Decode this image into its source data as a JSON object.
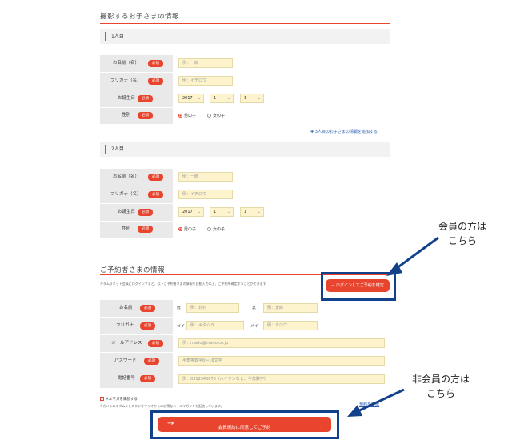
{
  "section1": {
    "title": "撮影するお子さまの情報",
    "child1": {
      "label": "1人目"
    },
    "child2": {
      "label": "2人目"
    },
    "fields": {
      "name_label": "お名前（名）",
      "kana_label": "フリガナ（名）",
      "birthday_label": "お誕生日",
      "gender_label": "性別",
      "required": "必須",
      "name_placeholder": "例：一郎",
      "kana_placeholder": "例：イチロウ",
      "year": "2017",
      "month": "1",
      "day": "1",
      "male": "男の子",
      "female": "女の子"
    },
    "add_child_link": "3人目のお子さまの情報を追加する"
  },
  "section2": {
    "title": "ご予約者さまの情報",
    "note": "キタムラネット会員にログインすると、以下ご予約者さまの情報を自動入力の上、ご予約を確定することができます",
    "login_button": "→ ログインしてご予約を確定",
    "fields": {
      "name_label": "お名前",
      "kana_label": "フリガナ",
      "email_label": "メールアドレス",
      "password_label": "パスワード",
      "phone_label": "電話番号",
      "required": "必須",
      "sei": "姓",
      "mei": "名",
      "sei_kana": "セイ",
      "mei_kana": "メイ",
      "sei_placeholder": "例：北村",
      "mei_placeholder": "例：太郎",
      "sei_kana_placeholder": "例：キタムラ",
      "mei_kana_placeholder": "例：タロウ",
      "email_placeholder": "例：mario@mario.co.jp",
      "password_placeholder": "半角英数字6〜16文字",
      "phone_placeholder": "例：0312345678（ハイフンなし、半角数字）"
    },
    "newsletter_label": "メルマガを購読する",
    "newsletter_note": "※カメラのキタムラ＆スタジオマリオからのお得なメールマガジンを配信しています。",
    "terms_link": "規約を確認",
    "submit_button": "会員規約に同意してご予約"
  },
  "callouts": {
    "member_line1": "会員の方は",
    "member_line2": "こちら",
    "nonmember_line1": "非会員の方は",
    "nonmember_line2": "こちら",
    "color": "#12418a"
  },
  "colors": {
    "accent": "#e8442e",
    "input_bg": "#fdf3cc",
    "label_bg": "#e9e9e9"
  }
}
